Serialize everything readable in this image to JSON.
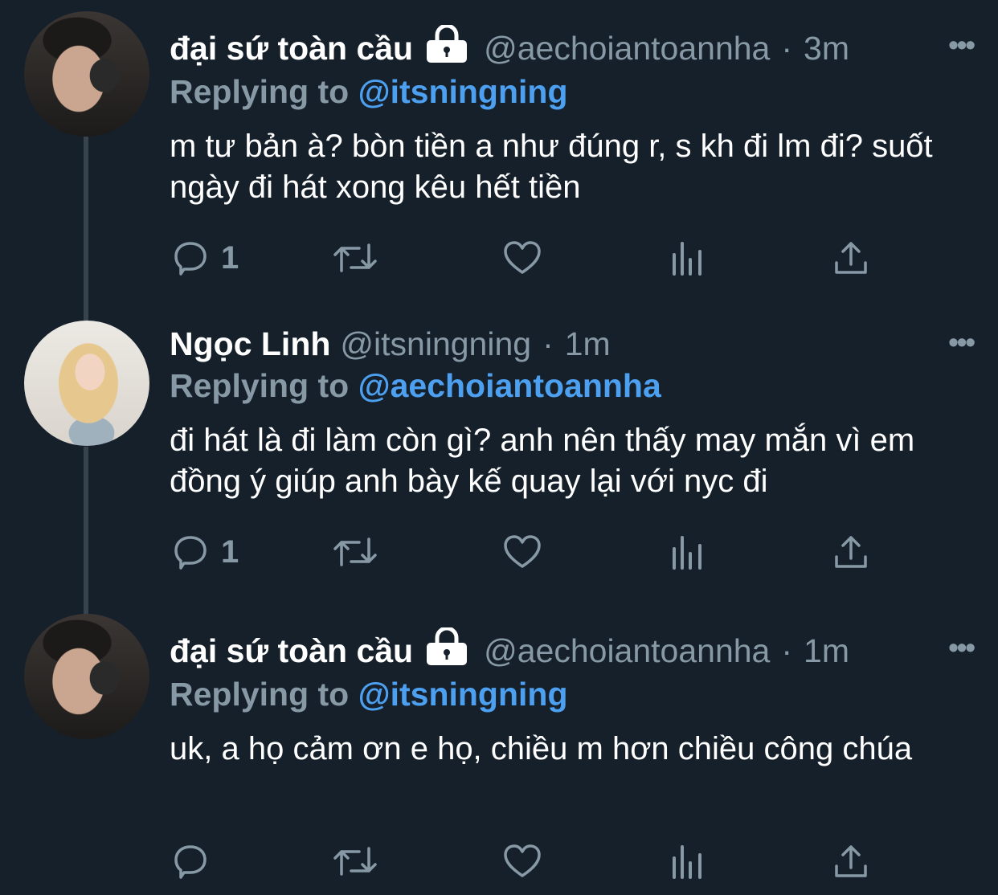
{
  "tweets": [
    {
      "name": "đại sứ toàn cầu",
      "locked": true,
      "handle": "@aechoiantoannha",
      "time": "3m",
      "replying_prefix": "Replying to",
      "replying_to": "@itsningning",
      "body": "m tư bản à? bòn tiền a như đúng r, s kh đi lm đi? suốt ngày đi hát xong kêu hết tiền",
      "reply_count": "1",
      "avatar": "boy-with-gun-avatar"
    },
    {
      "name": "Ngọc Linh",
      "locked": false,
      "handle": "@itsningning",
      "time": "1m",
      "replying_prefix": "Replying to",
      "replying_to": "@aechoiantoannha",
      "body": "đi hát là đi làm còn gì? anh nên thấy may mắn vì em đồng ý giúp anh bày kế quay lại với nyc đi",
      "reply_count": "1",
      "avatar": "blonde-girl-avatar"
    },
    {
      "name": "đại sứ toàn cầu",
      "locked": true,
      "handle": "@aechoiantoannha",
      "time": "1m",
      "replying_prefix": "Replying to",
      "replying_to": "@itsningning",
      "body": "uk, a họ cảm ơn e họ, chiều m hơn chiều công chúa",
      "reply_count": "",
      "avatar": "boy-with-gun-avatar"
    }
  ],
  "separator": "·",
  "icons": {
    "more": "more-dots-icon",
    "reply": "reply-bubble-icon",
    "retweet": "retweet-icon",
    "like": "heart-icon",
    "analytics": "analytics-icon",
    "share": "share-icon",
    "lock": "lock-icon"
  },
  "colors": {
    "background": "#15202b",
    "secondary_text": "#8899a6",
    "link": "#4da0f0",
    "thread_line": "#38444d"
  }
}
